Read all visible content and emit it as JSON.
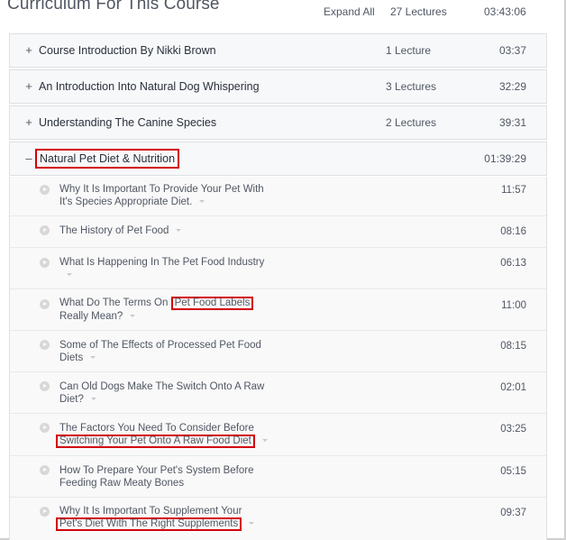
{
  "curriculum": {
    "title": "Curriculum For This Course",
    "expand_all": "Expand All",
    "total_lectures": "27 Lectures",
    "total_time": "03:43:06"
  },
  "sections": [
    {
      "toggle": "+",
      "title": "Course Introduction By Nikki Brown",
      "count": "1 Lecture",
      "time": "03:37"
    },
    {
      "toggle": "+",
      "title": "An Introduction Into Natural Dog Whispering",
      "count": "3 Lectures",
      "time": "32:29"
    },
    {
      "toggle": "+",
      "title": "Understanding The Canine Species",
      "count": "2 Lectures",
      "time": "39:31"
    },
    {
      "toggle": "–",
      "title": "Natural Pet Diet & Nutrition",
      "count": "",
      "time": "01:39:29"
    }
  ],
  "lessons": [
    {
      "line1": "Why It Is Important To Provide Your Pet With",
      "line2": "It's Species Appropriate Diet.",
      "time": "11:57"
    },
    {
      "line1": "The History of Pet Food",
      "time": "08:16"
    },
    {
      "line1": "What Is Happening In The Pet Food Industry",
      "time": "06:13"
    },
    {
      "line1_pre": "What Do The Terms On ",
      "line1_hl": "Pet Food Labels",
      "line2": "Really Mean?",
      "time": "11:00"
    },
    {
      "line1": "Some of The Effects of Processed Pet Food",
      "line2": "Diets",
      "time": "08:15"
    },
    {
      "line1": "Can Old Dogs Make The Switch Onto A Raw",
      "line2": "Diet?",
      "time": "02:01"
    },
    {
      "line1": "The Factors You Need To Consider Before",
      "line2_hl": "Switching Your Pet Onto A Raw Food Diet",
      "time": "03:25"
    },
    {
      "line1": "How To Prepare Your Pet's System Before",
      "line2": "Feeding Raw Meaty Bones",
      "time": "05:15"
    },
    {
      "line1": "Why It Is Important To Supplement Your",
      "line2_hl": "Pet's Diet With The Right Supplements",
      "time": "09:37"
    }
  ],
  "colors": {
    "highlight_box": "#d3000b",
    "section_bg": "#f7f8fa",
    "lesson_bg": "#f9f9f9",
    "text": "#505763"
  }
}
